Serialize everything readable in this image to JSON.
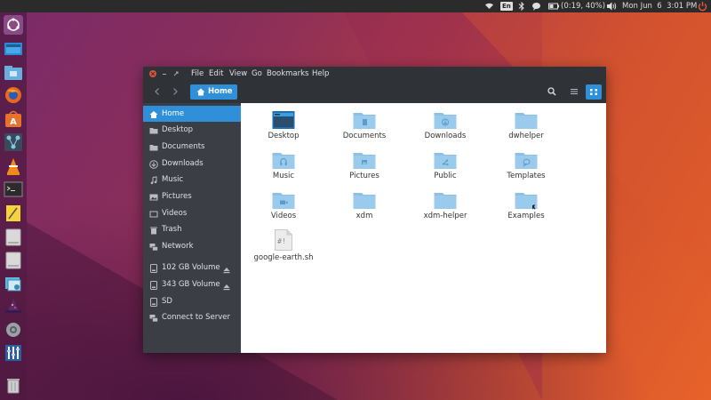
{
  "top_panel": {
    "battery": "(0:19, 40%)",
    "keyboard_layout": "En",
    "datetime": "Mon Jun  6  3:01 PM",
    "icons": [
      "wifi-icon",
      "keyboard-layout-icon",
      "bluetooth-icon",
      "battery-icon",
      "volume-icon",
      "power-icon",
      "chat-icon"
    ]
  },
  "launcher": {
    "items": [
      "ubuntu-dash-icon",
      "desktop-icon",
      "files-icon",
      "firefox-icon",
      "software-center-icon",
      "network-icon",
      "vlc-icon",
      "terminal-icon",
      "text-editor-icon",
      "drive-icon",
      "drive-icon",
      "screenshot-icon",
      "wizard-icon",
      "settings-icon",
      "mixer-icon",
      "trash-icon"
    ]
  },
  "window": {
    "menu": [
      "File",
      "Edit",
      "View",
      "Go",
      "Bookmarks",
      "Help"
    ],
    "breadcrumb": "Home"
  },
  "sidebar": {
    "places": [
      "Home",
      "Desktop",
      "Documents",
      "Downloads",
      "Music",
      "Pictures",
      "Videos",
      "Trash",
      "Network"
    ],
    "devices": [
      "102 GB Volume",
      "343 GB Volume",
      "SD",
      "Connect to Server"
    ]
  },
  "files": [
    {
      "name": "Desktop",
      "icon": "desktop-folder-icon"
    },
    {
      "name": "Documents",
      "icon": "documents-folder-icon"
    },
    {
      "name": "Downloads",
      "icon": "downloads-folder-icon"
    },
    {
      "name": "dwhelper",
      "icon": "folder-icon"
    },
    {
      "name": "Music",
      "icon": "music-folder-icon"
    },
    {
      "name": "Pictures",
      "icon": "pictures-folder-icon"
    },
    {
      "name": "Public",
      "icon": "public-folder-icon"
    },
    {
      "name": "Templates",
      "icon": "templates-folder-icon"
    },
    {
      "name": "Videos",
      "icon": "videos-folder-icon"
    },
    {
      "name": "xdm",
      "icon": "folder-icon"
    },
    {
      "name": "xdm-helper",
      "icon": "folder-icon"
    },
    {
      "name": "Examples",
      "icon": "examples-folder-icon"
    },
    {
      "name": "google-earth.sh",
      "icon": "script-file-icon"
    }
  ],
  "colors": {
    "accent": "#2f8fd8",
    "titlebar": "#2f3338",
    "sidebar": "#3b3f45",
    "folder": "#8cc0e6",
    "close_button": "#e0513c"
  }
}
